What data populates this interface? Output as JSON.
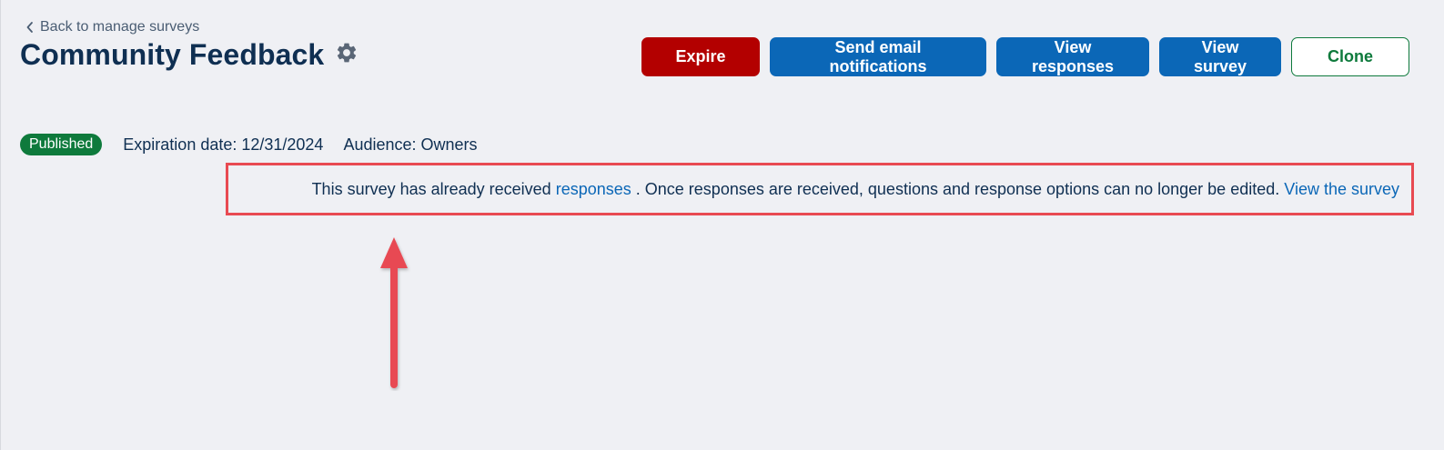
{
  "header": {
    "back_link": "Back to manage surveys",
    "title": "Community Feedback"
  },
  "actions": {
    "expire": "Expire",
    "send_email": "Send email notifications",
    "view_responses": "View responses",
    "view_survey": "View survey",
    "clone": "Clone"
  },
  "meta": {
    "status": "Published",
    "expiration": "Expiration date: 12/31/2024",
    "audience": "Audience: Owners"
  },
  "notice": {
    "text_before": "This survey has already received",
    "responses_link": "responses",
    "text_after": ". Once responses are received, questions and response options can no longer be edited.",
    "view_link": "View the survey"
  },
  "colors": {
    "background": "#eff0f4",
    "primary": "#0b67b7",
    "danger": "#b30000",
    "success": "#0e7a3c",
    "title": "#0f2f52",
    "annotation": "#e84a52"
  }
}
